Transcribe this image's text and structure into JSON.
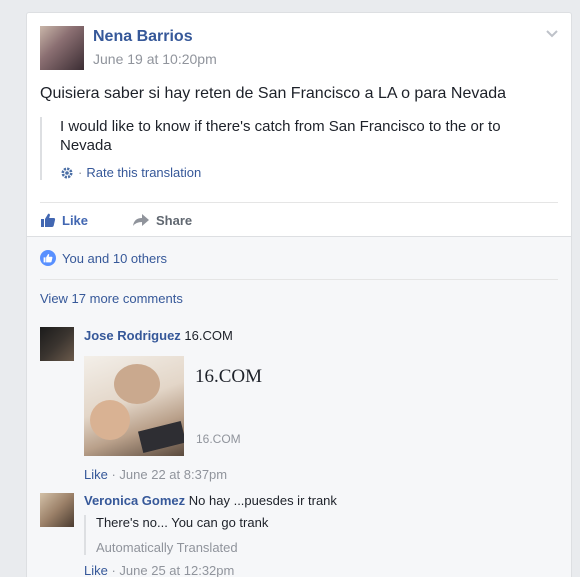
{
  "post": {
    "author": "Nena Barrios",
    "date": "June 19 at 10:20pm",
    "text": "Quisiera saber si hay reten de San Francisco a LA o para Nevada",
    "translation": "I would like to know if there's catch from San Francisco to the or to Nevada",
    "rate_sep": "·",
    "rate_label": "Rate this translation"
  },
  "actions": {
    "like": "Like",
    "share": "Share"
  },
  "reactions": {
    "text": "You and 10 others"
  },
  "comments": {
    "view_more": "View 17 more comments",
    "items": [
      {
        "author": "Jose Rodriguez",
        "text": "16.COM",
        "link": {
          "title": "16.COM",
          "domain": "16.COM"
        },
        "like": "Like",
        "sep": " · ",
        "time": "June 22 at 8:37pm"
      },
      {
        "author": "Veronica Gomez",
        "text": "No hay ...puesdes ir trank",
        "translation": "There's no... You can go trank",
        "note": "Automatically Translated",
        "like": "Like",
        "sep": " · ",
        "time": "June 25 at 12:32pm"
      }
    ]
  },
  "icons": [
    "chevron-down-icon",
    "gear-icon",
    "thumbs-up-icon",
    "share-arrow-icon",
    "like-badge-icon"
  ],
  "colors": {
    "link": "#365899",
    "like_active": "#4267b2",
    "meta": "#90949c",
    "badge": "#5890ff"
  }
}
